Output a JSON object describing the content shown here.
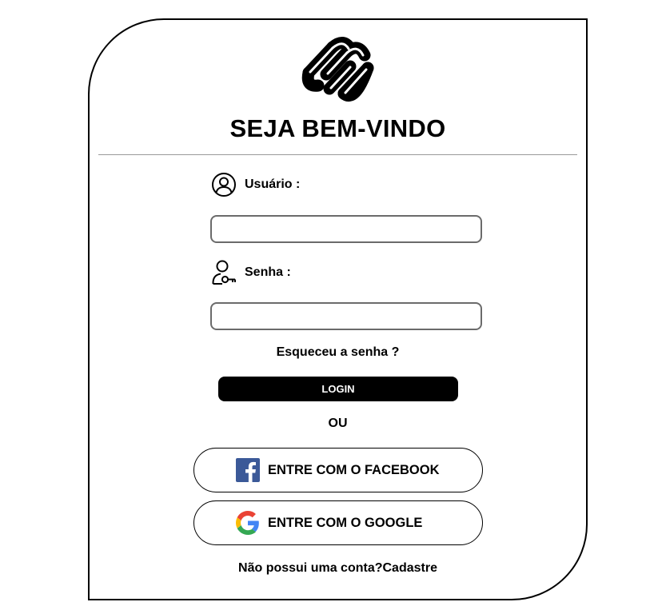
{
  "header": {
    "title": "SEJA BEM-VINDO",
    "logo_icon": "squarespace-logo-icon"
  },
  "form": {
    "user_label": "Usuário :",
    "user_icon": "user-circle-icon",
    "user_value": "",
    "password_label": "Senha :",
    "password_icon": "user-key-icon",
    "password_value": "",
    "forgot_label": "Esqueceu a senha ?",
    "login_label": "LOGIN",
    "or_label": "OU"
  },
  "social": {
    "facebook_label": "ENTRE COM O FACEBOOK",
    "facebook_icon": "facebook-icon",
    "facebook_color": "#3B5998",
    "google_label": "ENTRE COM O GOOGLE",
    "google_icon": "google-icon"
  },
  "footer": {
    "signup_prompt": "Não possui uma conta?",
    "signup_link": "Cadastre"
  }
}
